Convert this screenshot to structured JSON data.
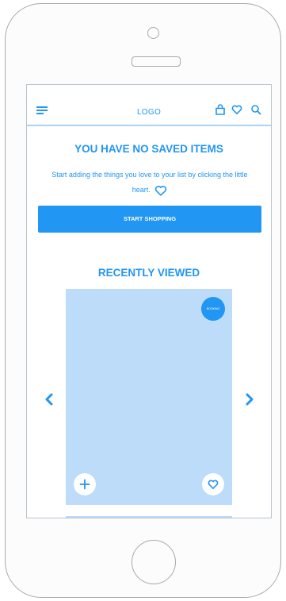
{
  "header": {
    "logo": "LOGO",
    "icons": [
      "menu-icon",
      "bag-icon",
      "heart-icon",
      "search-icon"
    ]
  },
  "empty_state": {
    "title": "YOU HAVE NO SAVED ITEMS",
    "message": "Start adding the things you love to your list by clicking the little heart.",
    "cta": "START SHOPPING"
  },
  "recently_viewed": {
    "title": "RECENTLY VIEWED",
    "item": {
      "badge": "BOOKING",
      "actions": [
        "add-icon",
        "heart-icon"
      ]
    },
    "nav_icons": [
      "chevron-left-icon",
      "chevron-right-icon"
    ]
  },
  "colors": {
    "accent": "#2196f3",
    "card": "#bcdcf9",
    "divider": "#a9d3f8",
    "device_outline": "#a9a9a9"
  }
}
